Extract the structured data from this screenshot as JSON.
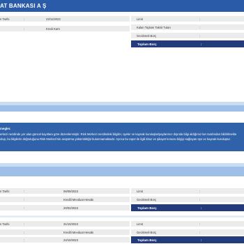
{
  "bank_name": "AT BANKASI A Ş",
  "section1": {
    "left_rows": [
      {
        "label": "n Tarihi",
        "colon": ":",
        "value": "23/11/2023"
      },
      {
        "label": "",
        "colon": ":",
        "value": "Kredi Kartı"
      }
    ],
    "right_rows": [
      {
        "label": "Limit",
        "colon": ":"
      },
      {
        "label": "Kalan Toplam Taksit Tutarı",
        "colon": ":"
      },
      {
        "label": "Gecikmeli Borç",
        "colon": ":"
      }
    ],
    "total_label": "Toplam Borç",
    "total_colon": ":"
  },
  "notice": {
    "title": "megler.",
    "text": "erkezi nezdinde yer alan güncel kayıtlara göre düzenlenmiştir. Risk Merkezi nezdindeki bilgiler, üyeler ve kaynak kuruluşlar/paylarımız dışında bilgi aldığımız ları tarafından bildirilmekte olup, bu bilgilerin doğruluğuna Risk Merkezi'nin araştırma yükümlülüğü bulunmamaktadır. Ayrıca bu rapor ile ilgili itiraz ve şikayet konusu bilgiyi sağlayan üye ve kaynak kuruluştur."
  },
  "section2": {
    "left_rows": [
      {
        "label": "n Tarihi",
        "colon": ":",
        "value": "06/09/2023"
      },
      {
        "label": "",
        "colon": ":",
        "value": "Kredili Mevduat Hesabı"
      },
      {
        "label": "",
        "colon": ":",
        "value": "20/02/2023"
      }
    ],
    "right_rows": [
      {
        "label": "Limit",
        "colon": ":"
      },
      {
        "label": "Gecikmeli Borç",
        "colon": ":"
      }
    ],
    "total_label": "Toplam Borç",
    "total_colon": ":"
  },
  "section3": {
    "left_rows": [
      {
        "label": "n Tarihi",
        "colon": ":",
        "value": "31/10/2023"
      },
      {
        "label": "",
        "colon": ":",
        "value": "Kredili Mevduat Hesabı"
      },
      {
        "label": "",
        "colon": ":",
        "value": "24/10/2023"
      }
    ],
    "right_rows": [
      {
        "label": "Limit",
        "colon": ":"
      },
      {
        "label": "Gecikmeli Borç",
        "colon": ":"
      }
    ],
    "total_label": "Toplam Borç",
    "total_colon": ":"
  }
}
